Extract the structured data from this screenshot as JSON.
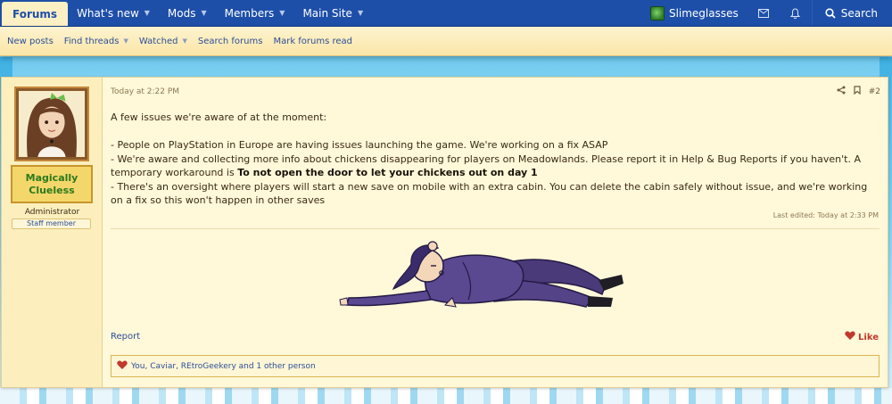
{
  "nav": {
    "tabs": [
      {
        "label": "Forums",
        "active": true
      },
      {
        "label": "What's new"
      },
      {
        "label": "Mods"
      },
      {
        "label": "Members"
      },
      {
        "label": "Main Site"
      }
    ],
    "username": "Slimeglasses",
    "search_label": "Search"
  },
  "subnav": {
    "items": [
      "New posts",
      "Find threads",
      "Watched",
      "Search forums",
      "Mark forums read"
    ]
  },
  "post": {
    "date": "Today at 2:22 PM",
    "number": "#2",
    "author": {
      "name_line1": "Magically",
      "name_line2": "Clueless",
      "title": "Administrator",
      "badge": "Staff member"
    },
    "body": {
      "intro": "A few issues we're aware of at the moment:",
      "line1": "- People on PlayStation in Europe are having issues launching the game. We're working on a fix ASAP",
      "line2a": "- We're aware and collecting more info about chickens disappearing for players on Meadowlands. Please report it in Help & Bug Reports if you haven't. A temporary workaround is ",
      "line2b": "To not open the door to let your chickens out on day 1",
      "line3": "- There's an oversight where players will start a new save on mobile with an extra cabin. You can delete the cabin safely without issue, and we're working on a fix so this won't happen in other saves"
    },
    "last_edited": "Last edited: Today at 2:33 PM",
    "report_label": "Report",
    "like_label": "Like",
    "reactions_text": "You, Caviar, REtroGeekery and 1 other person"
  },
  "colors": {
    "nav_blue": "#1e4fa8",
    "post_bg": "#fff8d9",
    "link": "#2a4f97",
    "like_red": "#c0392b"
  }
}
